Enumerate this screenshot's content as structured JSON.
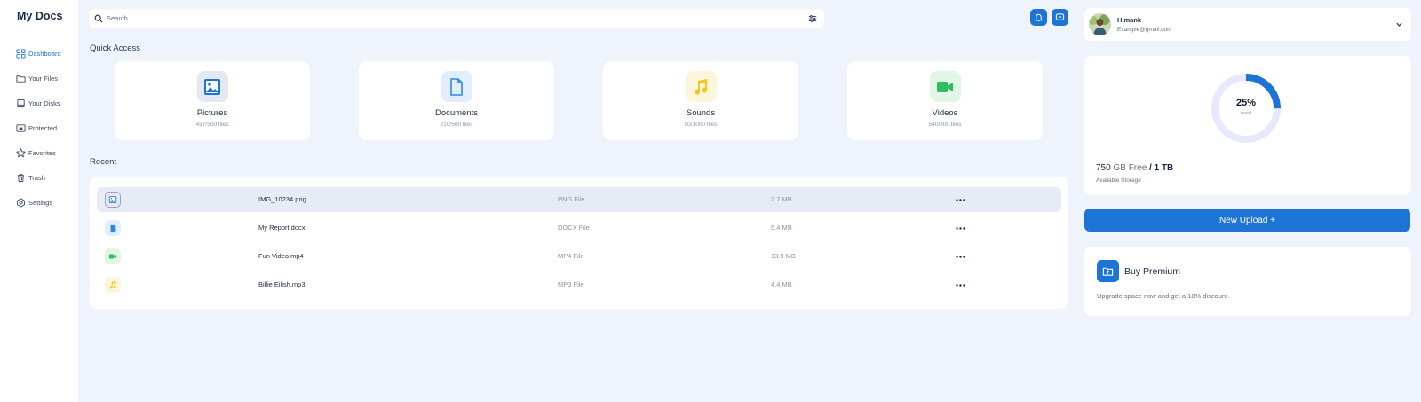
{
  "app": {
    "title": "My Docs"
  },
  "sidebar": {
    "items": [
      {
        "label": "Dashboard",
        "icon": "grid-icon",
        "active": true
      },
      {
        "label": "Your Files",
        "icon": "folder-icon"
      },
      {
        "label": "Your Disks",
        "icon": "disk-icon"
      },
      {
        "label": "Protected",
        "icon": "lock-folder-icon"
      },
      {
        "label": "Favorites",
        "icon": "star-icon"
      },
      {
        "label": "Trash",
        "icon": "trash-icon"
      },
      {
        "label": "Settings",
        "icon": "gear-icon"
      }
    ]
  },
  "search": {
    "placeholder": "Search",
    "value": ""
  },
  "header": {
    "notification_icon": "bell-icon",
    "message_icon": "chat-icon"
  },
  "quick_access": {
    "title": "Quick Access",
    "items": [
      {
        "label": "Pictures",
        "count": "437/500 files",
        "icon": "image-icon",
        "color": "#1e74d4",
        "bg": "#e3e8f3"
      },
      {
        "label": "Documents",
        "count": "210/500 files",
        "icon": "document-icon",
        "color": "#2b8ae6",
        "bg": "#e2eefb"
      },
      {
        "label": "Sounds",
        "count": "90/1000 files",
        "icon": "music-icon",
        "color": "#f5c518",
        "bg": "#fdf6dc"
      },
      {
        "label": "Videos",
        "count": "540/800 files",
        "icon": "video-icon",
        "color": "#2fbf5f",
        "bg": "#e2f6e8"
      }
    ]
  },
  "recent": {
    "title": "Recent",
    "rows": [
      {
        "name": "IMG_10234.png",
        "type": "PNG File",
        "size": "2.7 MB",
        "icon": "image-icon",
        "color": "#1e74d4",
        "bg": "#e3e8f3",
        "selected": true
      },
      {
        "name": "My Report.docx",
        "type": "DOCX File",
        "size": "5.4 MB",
        "icon": "document-icon",
        "color": "#2b8ae6",
        "bg": "#e2eefb",
        "selected": false
      },
      {
        "name": "Fun Video.mp4",
        "type": "MP4 File",
        "size": "13.9 MB",
        "icon": "video-icon",
        "color": "#2fbf5f",
        "bg": "#e2f6e8",
        "selected": false
      },
      {
        "name": "Billie Eilish.mp3",
        "type": "MP3 File",
        "size": "4.4 MB",
        "icon": "music-icon",
        "color": "#f5c518",
        "bg": "#fdf6dc",
        "selected": false
      }
    ]
  },
  "profile": {
    "name": "Himank",
    "email": "Example@gmail.com"
  },
  "storage": {
    "percent_label": "25%",
    "used_fraction": 0.25,
    "sub_label": "used",
    "free_amount": "750",
    "free_unit": "GB Free",
    "separator": "/",
    "total": "1 TB",
    "caption": "Available Storage"
  },
  "upload": {
    "label": "New Upload +"
  },
  "premium": {
    "title": "Buy Premium",
    "text": "Upgrade space now and get a 18% discount."
  },
  "colors": {
    "accent": "#1e74d4",
    "background": "#eef3fc",
    "donut_track": "#e6e8fb"
  }
}
